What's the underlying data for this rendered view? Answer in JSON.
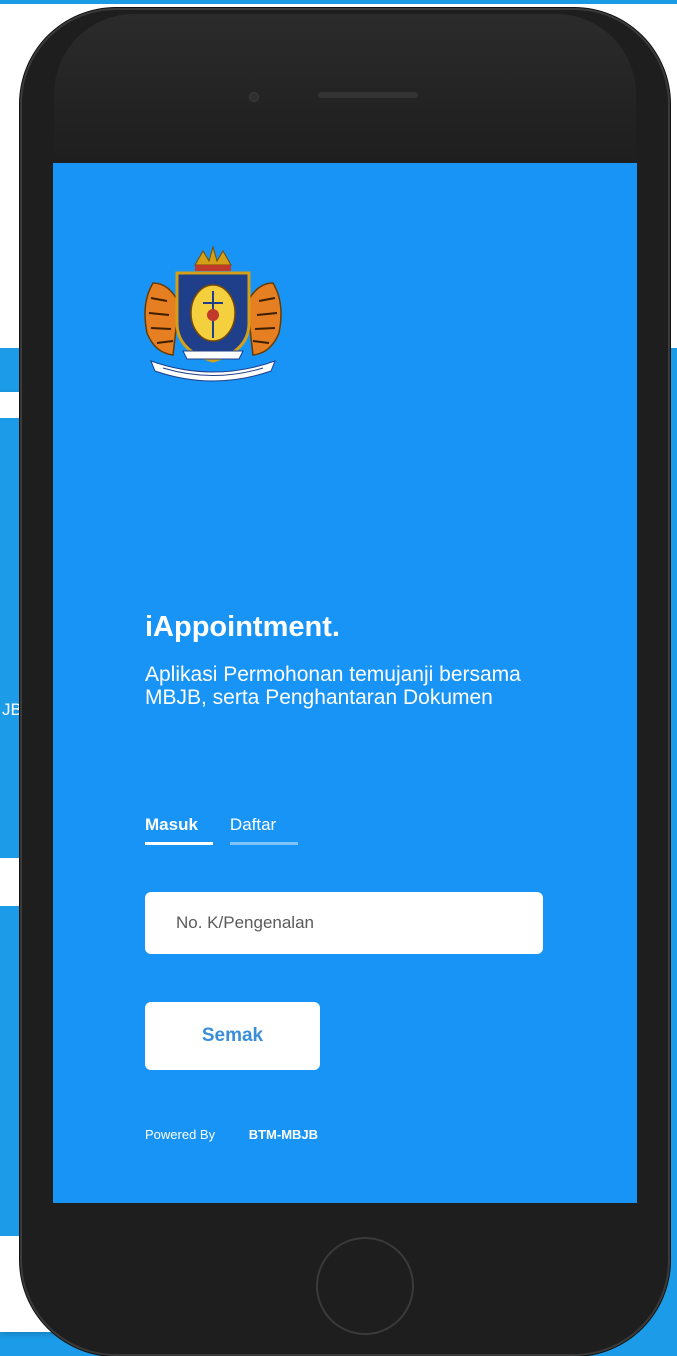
{
  "background": {
    "fragment_text": "JB"
  },
  "app": {
    "title": "iAppointment.",
    "subtitle": "Aplikasi Permohonan temujanji bersama MBJB, serta Penghantaran Dokumen",
    "logo_icon": "mbjb-crest-icon",
    "colors": {
      "screen_bg": "#1794f5",
      "page_bg": "#1c9ce8",
      "button_text": "#3b8ed6"
    }
  },
  "tabs": [
    {
      "label": "Masuk",
      "active": true
    },
    {
      "label": "Daftar",
      "active": false
    }
  ],
  "form": {
    "id_placeholder": "No. K/Pengenalan",
    "id_value": "",
    "submit_label": "Semak"
  },
  "footer": {
    "powered_label": "Powered By",
    "brand": "BTM-MBJB"
  }
}
